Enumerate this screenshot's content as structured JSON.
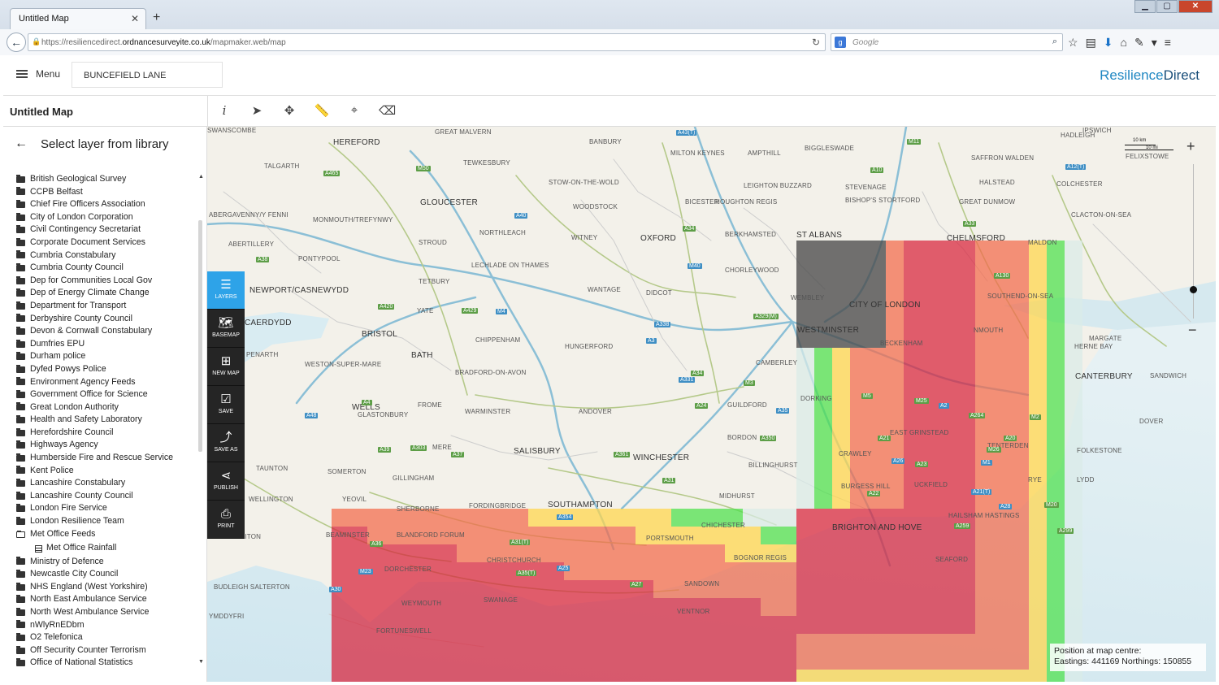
{
  "browser": {
    "tab_title": "Untitled Map",
    "url_prefix": "https://resiliencedirect.",
    "url_domain": "ordnancesurveyite.co.uk",
    "url_path": "/mapmaker.web/map",
    "search_engine_placeholder": "Google"
  },
  "header": {
    "menu_label": "Menu",
    "search_value": "BUNCEFIELD LANE",
    "brand_part1": "Resilience",
    "brand_part2": "Direct"
  },
  "toolbar": {
    "map_title": "Untitled Map",
    "tools": [
      "info-icon",
      "select-pointer-icon",
      "pan-icon",
      "measure-ruler-icon",
      "locate-target-icon",
      "clear-icon"
    ]
  },
  "sidebar": {
    "title": "Select layer from library",
    "layers": [
      "British Geological Survey",
      "CCPB Belfast",
      "Chief Fire Officers Association",
      "City of London Corporation",
      "Civil Contingency Secretariat",
      "Corporate Document Services",
      "Cumbria Constabulary",
      "Cumbria County Council",
      "Dep for Communities Local Gov",
      "Dep of Energy Climate Change",
      "Department for Transport",
      "Derbyshire County Council",
      "Devon & Cornwall Constabulary",
      "Dumfries EPU",
      "Durham police",
      "Dyfed Powys Police",
      "Environment Agency Feeds",
      "Government Office for Science",
      "Great London Authority",
      "Health and Safety Laboratory",
      "Herefordshire Council",
      "Highways Agency",
      "Humberside Fire and Rescue Service",
      "Kent Police",
      "Lancashire Constabulary",
      "Lancashire County Council",
      "London Fire Service",
      "London Resilience Team"
    ],
    "open_folder": "Met Office Feeds",
    "open_folder_child": "Met Office Rainfall",
    "layers_after": [
      "Ministry of Defence",
      "Newcastle City Council",
      "NHS England (West Yorkshire)",
      "North East Ambulance Service",
      "North West Ambulance Service",
      "nWlyRnEDbm",
      "O2 Telefonica",
      "Off Security Counter Terrorism",
      "Office of National Statistics"
    ]
  },
  "side_tools": {
    "layers": "LAYERS",
    "basemap": "BASEMAP",
    "new_map": "NEW MAP",
    "save": "SAVE",
    "save_as": "SAVE AS",
    "publish": "PUBLISH",
    "print": "PRINT"
  },
  "map": {
    "scale_km": "10 km",
    "scale_mi": "10 mi",
    "zoom_level_fraction": 0.8,
    "position_label": "Position at map centre:",
    "position_value": "Eastings: 441169 Northings: 150855",
    "places": [
      "HEREFORD",
      "GREAT MALVERN",
      "BANBURY",
      "MILTON KEYNES",
      "AMPTHILL",
      "BIGGLESWADE",
      "SAFFRON WALDEN",
      "HADLEIGH",
      "IPSWICH",
      "FELIXSTOWE",
      "TALGARTH",
      "TEWKESBURY",
      "STOW-ON-THE-WOLD",
      "LEIGHTON BUZZARD",
      "STEVENAGE",
      "HALSTEAD",
      "COLCHESTER",
      "GLOUCESTER",
      "WOODSTOCK",
      "BICESTER",
      "HOUGHTON REGIS",
      "BISHOP'S STORTFORD",
      "GREAT DUNMOW",
      "CLACTON-ON-SEA",
      "ABERGAVENNY/Y FENNI",
      "MONMOUTH/TREFYNWY",
      "NORTHLEACH",
      "WITNEY",
      "OXFORD",
      "BERKHAMSTED",
      "ST ALBANS",
      "CHELMSFORD",
      "MALDON",
      "ABERTILLERY",
      "STROUD",
      "PONTYPOOL",
      "LECHLADE ON THAMES",
      "CHORLEYWOOD",
      "NEWPORT/CASNEWYDD",
      "TETBURY",
      "WANTAGE",
      "DIDCOT",
      "WEMBLEY",
      "CITY OF LONDON",
      "SOUTHEND-ON-SEA",
      "CAERDYDD",
      "BRISTOL",
      "YATE",
      "CHIPPENHAM",
      "WESTMINSTER",
      "MARGATE",
      "PENARTH",
      "BATH",
      "HUNGERFORD",
      "HERNE BAY",
      "WESTON-SUPER-MARE",
      "BRADFORD-ON-AVON",
      "CAMBERLEY",
      "BECKENHAM",
      "CANTERBURY",
      "SANDWICH",
      "WELLS",
      "FROME",
      "WARMINSTER",
      "ANDOVER",
      "GUILDFORD",
      "DORKING",
      "DOVER",
      "GLASTONBURY",
      "MERE",
      "SALISBURY",
      "WINCHESTER",
      "BORDON",
      "EAST GRINSTEAD",
      "TENTERDEN",
      "FOLKESTONE",
      "TAUNTON",
      "SOMERTON",
      "GILLINGHAM",
      "CRAWLEY",
      "BILLINGHURST",
      "MIDHURST",
      "BURGESS HILL",
      "UCKFIELD",
      "RYE",
      "LYDD",
      "WELLINGTON",
      "YEOVIL",
      "SHERBORNE",
      "FORDINGBRIDGE",
      "SOUTHAMPTON",
      "HAILSHAM",
      "HASTINGS",
      "HONITON",
      "BEAMINSTER",
      "BLANDFORD FORUM",
      "PORTSMOUTH",
      "CHICHESTER",
      "BRIGHTON AND HOVE",
      "DORCHESTER",
      "CHRISTCHURCH",
      "BOGNOR REGIS",
      "SEAFORD",
      "BUDLEIGH SALTERTON",
      "SANDOWN",
      "WEYMOUTH",
      "VENTNOR",
      "SWANAGE",
      "FORTUNESWELL",
      "YMDDYFRI",
      "NMOUTH",
      "SWANSCOMBE"
    ],
    "roads": [
      "A43(T)",
      "A465",
      "M50",
      "A40",
      "A429",
      "A420",
      "M4",
      "A34",
      "A329(M)",
      "M40",
      "M11",
      "A10",
      "A12(T)",
      "A130",
      "A33",
      "A331",
      "M3",
      "A31",
      "A354",
      "A31(T)",
      "A35(T)",
      "M23",
      "A21",
      "A259",
      "A28",
      "A299",
      "A20",
      "A2",
      "M2",
      "A264",
      "A26",
      "A23",
      "A22",
      "A21(T)",
      "M26",
      "M20",
      "M1",
      "M25",
      "M5",
      "A48",
      "A38",
      "A4",
      "A3",
      "A27",
      "A24",
      "A25",
      "A303",
      "A36",
      "A30",
      "A37",
      "A39",
      "A35",
      "A350",
      "A361",
      "A338",
      "A34"
    ],
    "heatmap_colors": [
      "#4a4a4a",
      "#d8233a",
      "#f26a4a",
      "#ffd54a",
      "#4be04a"
    ]
  }
}
